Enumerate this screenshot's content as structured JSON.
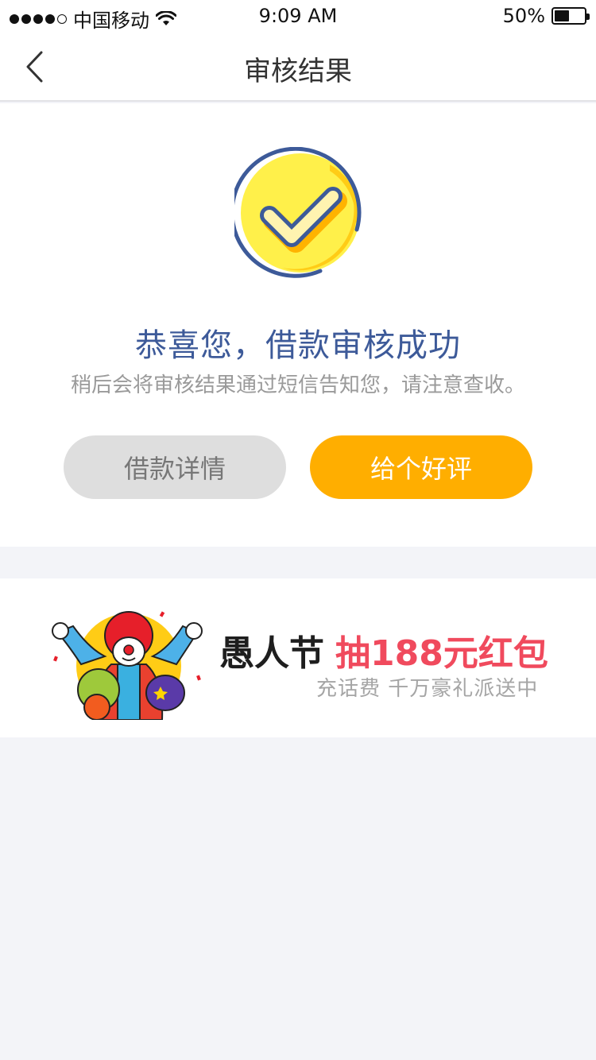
{
  "status_bar": {
    "carrier": "中国移动",
    "time": "9:09 AM",
    "battery": "50%",
    "battery_level": 0.5
  },
  "nav": {
    "title": "审核结果",
    "back_icon": "chevron-left-icon"
  },
  "result": {
    "icon": "check-circle-icon",
    "headline": "恭喜您，借款审核成功",
    "subtext": "稍后会将审核结果通过短信告知您，请注意查收。",
    "detail_button": "借款详情",
    "review_button": "给个好评"
  },
  "banner": {
    "title_black": "愚人节",
    "title_red": "抽188元红包",
    "subtitle": "充话费 千万豪礼派送中"
  },
  "colors": {
    "primary_orange": "#ffae00",
    "headline_blue": "#3d5a99",
    "banner_red": "#f04a5d",
    "background": "#f3f4f8"
  }
}
